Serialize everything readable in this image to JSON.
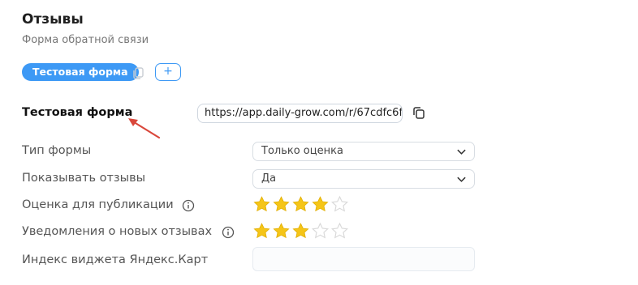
{
  "header": {
    "title": "Отзывы",
    "subtitle": "Форма обратной связи"
  },
  "tabs": [
    {
      "label": "Тестовая форма",
      "active": true
    }
  ],
  "add_tab_label": "+",
  "form": {
    "name": "Тестовая форма",
    "url": "https://app.daily-grow.com/r/67cdfc6f"
  },
  "fields": {
    "form_type": {
      "label": "Тип формы",
      "value": "Только оценка"
    },
    "show_reviews": {
      "label": "Показывать отзывы",
      "value": "Да"
    },
    "publish_rating": {
      "label": "Оценка для публикации",
      "rating": 4,
      "max": 5
    },
    "notify_rating": {
      "label": "Уведомления о новых отзывах",
      "rating": 3,
      "max": 5
    },
    "yandex_index": {
      "label": "Индекс виджета Яндекс.Карт",
      "value": ""
    }
  },
  "colors": {
    "accent": "#3d99f5",
    "star_filled": "#f5c518",
    "star_empty": "#d9d9d9",
    "annotation_arrow": "#d9473b"
  },
  "icons": {
    "copy": "copy-icon",
    "info": "info-icon",
    "chevron": "chevron-down-icon",
    "star": "star-icon"
  }
}
